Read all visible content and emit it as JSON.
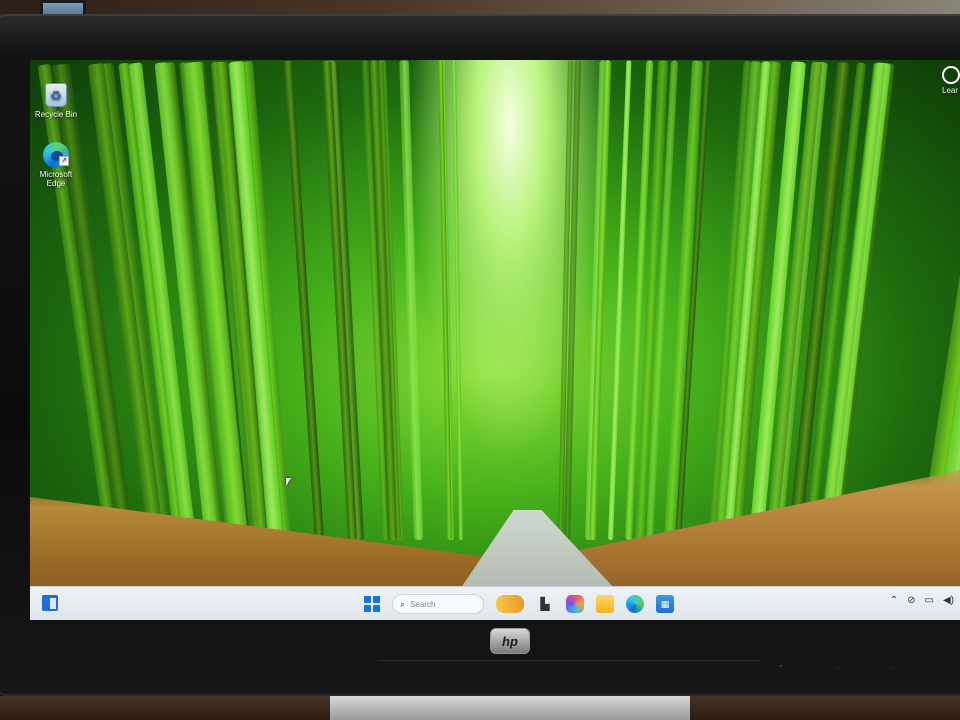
{
  "desktop": {
    "icons": [
      {
        "label": "Recycle Bin",
        "icon": "recycle-bin-icon"
      },
      {
        "label": "Microsoft Edge",
        "icon": "edge-icon"
      }
    ],
    "widget": {
      "label": "Lear",
      "icon": "learn-about-picture-icon"
    }
  },
  "taskbar": {
    "search": {
      "placeholder": "Search"
    },
    "apps": [
      "weather-widget-icon",
      "task-view-icon",
      "copilot-icon",
      "file-explorer-icon",
      "edge-icon",
      "microsoft-store-icon"
    ],
    "tray": [
      "chevron-up-icon",
      "network-icon",
      "display-icon",
      "volume-icon"
    ]
  },
  "monitor": {
    "brand": "hp"
  },
  "colors": {
    "taskbar_bg": "#eef2f6",
    "accent": "#1473e6",
    "wallpaper_green": "#46b01a",
    "wallpaper_grass": "#b78a3a"
  }
}
